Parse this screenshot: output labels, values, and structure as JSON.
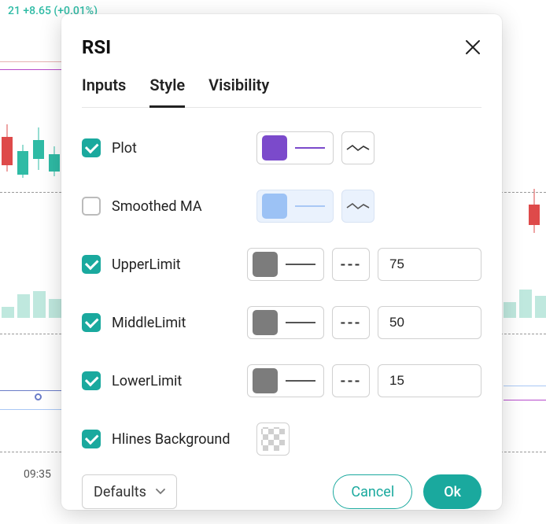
{
  "bg": {
    "price": "21 +8.65 (+0.01%)",
    "time": "09:35"
  },
  "panel": {
    "title": "RSI",
    "tabs": {
      "inputs": "Inputs",
      "style": "Style",
      "visibility": "Visibility",
      "active": "style"
    },
    "rows": {
      "plot": {
        "checked": true,
        "label": "Plot",
        "color": "#7b4acb"
      },
      "smoothedMA": {
        "checked": false,
        "label": "Smoothed MA",
        "color": "#9cc2f5"
      },
      "upperLimit": {
        "checked": true,
        "label": "UpperLimit",
        "color": "#7c7c7c",
        "value": "75"
      },
      "middleLimit": {
        "checked": true,
        "label": "MiddleLimit",
        "color": "#7c7c7c",
        "value": "50"
      },
      "lowerLimit": {
        "checked": true,
        "label": "LowerLimit",
        "color": "#7c7c7c",
        "value": "15"
      },
      "hlinesBg": {
        "checked": true,
        "label": "Hlines Background"
      }
    },
    "footer": {
      "defaults": "Defaults",
      "cancel": "Cancel",
      "ok": "Ok"
    }
  }
}
